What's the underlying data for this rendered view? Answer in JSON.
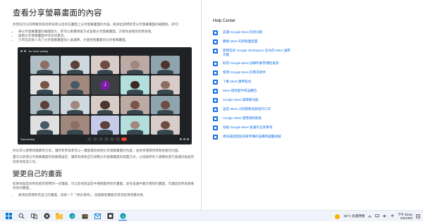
{
  "article": {
    "heading1": "查看分享螢幕畫面的內容",
    "intro": "你現在可以同時看到其他參與者以及你在畫面上分享螢幕畫面的內容，將滑鼠游標移至分享螢幕畫面的縮圖後，即可：",
    "bullets": [
      "將分享螢幕畫面的縮圖放大，即可以重疊視窗方式查看分享螢幕畫面，方便你查看其他參與者。",
      "展開分享螢幕畫面中的任何資訊。",
      "只有在其他人為了分享螢幕畫面加入會議時，才能拖曳畫面的分享螢幕畫面。"
    ],
    "para2": "你也可以使用快捷鍵等方式，讓所有參與者可以一覽無遺地檢視分享螢幕畫面的內容，並依序選擇何時要查看的內容。",
    "para3": "還可以新增分享螢幕畫面的快捷鍵設定，讓參與者能自行調整分享螢幕畫面的配置方式，以協助所有人順暢地進行會議討論並有效率地完成工作。",
    "heading2": "變更自己的畫面",
    "para4": "如果你與其他參與者有使用同一台電腦，可以在視訊設定中選擇變更你的畫面，並在會議中顯示相同的畫面，可讓其他參與者看見你的畫面。",
    "bullet2": "將滑鼠游標移至自己的畫面，再按一下「更多選項」，就能變更畫面背景或套用視覺效果。"
  },
  "meet": {
    "window_title": "Jon Carlos' meeting",
    "bottom_label": "Team meeting",
    "presenter_initial": "J",
    "tile_colors": [
      "#8d6e63",
      "#5d4037",
      "#6d4c41",
      "#a1887f",
      "#4e342e",
      "#795548",
      "#455a64",
      "#6d4c41",
      "#3e2723",
      "#8d6e63",
      "#5d4037",
      "#a1887f",
      "#4e342e",
      "#795548",
      "#6d4c41",
      "#455a64",
      "#8d6e63",
      "#5d4037",
      "#a1887f",
      "#6d4c41"
    ]
  },
  "help_center": {
    "title": "Help Center",
    "items": [
      "認識 Google Meet 的新功能",
      "瞭解 Meet 的新版面配置",
      "使用包含 Google Workspace 在內的 Meet 通用功能",
      "取得 Google Meet 訓練和教學課程資源",
      "使用 Google Meet 的需求條件",
      "下載 Meet 應用程式",
      "Meet 視訊配件和設備包",
      "Google Meet 無障礙功能",
      "設定 Meet 以利團隊成員協同工作",
      "Google Meet 使用限制政策",
      "協助 Google Meet 會議的主席事項",
      "視訊通話開始前要準備的設備和疑難排解"
    ]
  },
  "taskbar": {
    "weather": "35°C 多雲時晴",
    "time": "下午 03:54",
    "date": "2021/6/8",
    "lang": "中"
  }
}
